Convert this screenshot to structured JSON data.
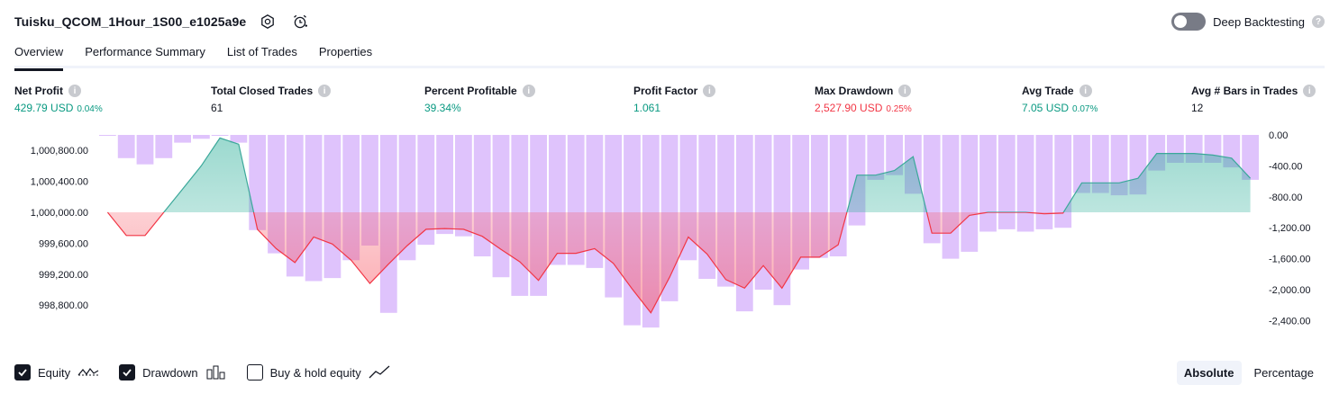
{
  "header": {
    "strategy_name": "Tuisku_QCOM_1Hour_1S00_e1025a9e",
    "deep_backtesting_label": "Deep Backtesting",
    "deep_backtesting_enabled": false
  },
  "tabs": [
    {
      "label": "Overview",
      "active": true
    },
    {
      "label": "Performance Summary",
      "active": false
    },
    {
      "label": "List of Trades",
      "active": false
    },
    {
      "label": "Properties",
      "active": false
    }
  ],
  "metrics": [
    {
      "label": "Net Profit",
      "value": "429.79 USD",
      "pct": "0.04%",
      "color": "green"
    },
    {
      "label": "Total Closed Trades",
      "value": "61",
      "pct": "",
      "color": "dark"
    },
    {
      "label": "Percent Profitable",
      "value": "39.34%",
      "pct": "",
      "color": "green"
    },
    {
      "label": "Profit Factor",
      "value": "1.061",
      "pct": "",
      "color": "green"
    },
    {
      "label": "Max Drawdown",
      "value": "2,527.90 USD",
      "pct": "0.25%",
      "color": "red"
    },
    {
      "label": "Avg Trade",
      "value": "7.05 USD",
      "pct": "0.07%",
      "color": "green"
    },
    {
      "label": "Avg # Bars in Trades",
      "value": "12",
      "pct": "",
      "color": "dark"
    }
  ],
  "legend": {
    "equity_label": "Equity",
    "equity_checked": true,
    "drawdown_label": "Drawdown",
    "drawdown_checked": true,
    "buyhold_label": "Buy & hold equity",
    "buyhold_checked": false
  },
  "scale_switch": {
    "absolute_label": "Absolute",
    "percentage_label": "Percentage",
    "active": "Absolute"
  },
  "colors": {
    "green": "#089981",
    "red": "#f23645",
    "drawdown_bar": "#d9b8fb",
    "equity_pos_line": "#3ba89a",
    "equity_neg_line": "#f23645"
  },
  "chart_data": {
    "type": "line",
    "trade_ticks": [
      "1",
      "5",
      "9",
      "13",
      "17",
      "21",
      "25",
      "29",
      "33",
      "37",
      "41",
      "45",
      "49",
      "53",
      "57",
      "61"
    ],
    "left_axis_ticks": [
      "1,000,800.00",
      "1,000,400.00",
      "1,000,000.00",
      "999,600.00",
      "999,200.00",
      "998,800.00"
    ],
    "right_axis_ticks": [
      "0.00",
      "-400.00",
      "-800.00",
      "-1,200.00",
      "-1,600.00",
      "-2,000.00",
      "-2,400.00"
    ],
    "equity_baseline": 1000000,
    "equity_ylim": [
      998500,
      1001000
    ],
    "drawdown_ylim": [
      -2500,
      0
    ],
    "series": [
      {
        "name": "Equity",
        "x": [
          1,
          2,
          3,
          4,
          5,
          6,
          7,
          8,
          9,
          10,
          11,
          12,
          13,
          14,
          15,
          16,
          17,
          18,
          19,
          20,
          21,
          22,
          23,
          24,
          25,
          26,
          27,
          28,
          29,
          30,
          31,
          32,
          33,
          34,
          35,
          36,
          37,
          38,
          39,
          40,
          41,
          42,
          43,
          44,
          45,
          46,
          47,
          48,
          49,
          50,
          51,
          52,
          53,
          54,
          55,
          56,
          57,
          58,
          59,
          60,
          61,
          62
        ],
        "values": [
          1000000,
          999700,
          999700,
          1000000,
          1000300,
          1000600,
          1000960,
          1000880,
          999780,
          999530,
          999350,
          999680,
          999590,
          999380,
          999080,
          999330,
          999570,
          999780,
          999790,
          999780,
          999690,
          999520,
          999360,
          999120,
          999470,
          999470,
          999530,
          999340,
          999010,
          998700,
          999160,
          999680,
          999460,
          999130,
          999020,
          999310,
          999020,
          999420,
          999420,
          999580,
          1000480,
          1000480,
          1000540,
          1000720,
          999730,
          999730,
          999960,
          1000000,
          1000000,
          1000000,
          999980,
          999990,
          1000380,
          1000380,
          1000380,
          1000440,
          1000760,
          1000760,
          1000760,
          1000740,
          1000700,
          1000440
        ]
      },
      {
        "name": "Drawdown",
        "x": [
          1,
          2,
          3,
          4,
          5,
          6,
          7,
          8,
          9,
          10,
          11,
          12,
          13,
          14,
          15,
          16,
          17,
          18,
          19,
          20,
          21,
          22,
          23,
          24,
          25,
          26,
          27,
          28,
          29,
          30,
          31,
          32,
          33,
          34,
          35,
          36,
          37,
          38,
          39,
          40,
          41,
          42,
          43,
          44,
          45,
          46,
          47,
          48,
          49,
          50,
          51,
          52,
          53,
          54,
          55,
          56,
          57,
          58,
          59,
          60,
          61,
          62
        ],
        "values": [
          0,
          -300,
          -380,
          -300,
          -100,
          -50,
          0,
          -100,
          -1230,
          -1530,
          -1830,
          -1890,
          -1850,
          -1620,
          -1430,
          -2300,
          -1620,
          -1420,
          -1280,
          -1310,
          -1570,
          -1840,
          -2080,
          -2080,
          -1680,
          -1680,
          -1720,
          -2100,
          -2460,
          -2490,
          -2150,
          -1620,
          -1860,
          -1960,
          -2280,
          -2000,
          -2200,
          -1740,
          -1590,
          -1570,
          -1170,
          -580,
          -520,
          -760,
          -1400,
          -1600,
          -1510,
          -1250,
          -1220,
          -1250,
          -1220,
          -1200,
          -750,
          -750,
          -780,
          -770,
          -460,
          -360,
          -360,
          -360,
          -420,
          -580
        ]
      }
    ]
  }
}
